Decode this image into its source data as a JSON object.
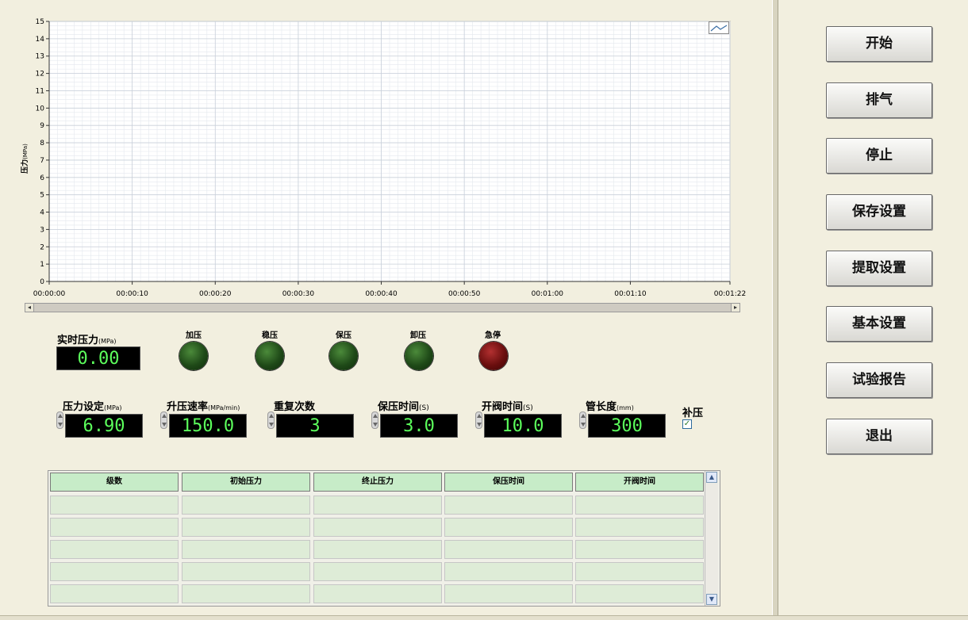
{
  "chart_data": {
    "type": "line",
    "ylabel": "压力",
    "ylabel_unit": "(MPa)",
    "ylim": [
      0,
      15
    ],
    "y_ticks": [
      "0",
      "1",
      "2",
      "3",
      "4",
      "5",
      "6",
      "7",
      "8",
      "9",
      "10",
      "11",
      "12",
      "13",
      "14",
      "15"
    ],
    "x_ticks": [
      "00:00:00",
      "00:00:10",
      "00:00:20",
      "00:00:30",
      "00:00:40",
      "00:00:50",
      "00:01:00",
      "00:01:10",
      "00:01:22"
    ],
    "x_tick_seconds": [
      0,
      10,
      20,
      30,
      40,
      50,
      60,
      70,
      82
    ],
    "xlim_seconds": [
      0,
      82
    ],
    "grid": true,
    "series": []
  },
  "realtime": {
    "label": "实时压力",
    "unit": "(MPa)",
    "value": "0.00"
  },
  "lamps": [
    {
      "label": "加压",
      "color": "green"
    },
    {
      "label": "稳压",
      "color": "green"
    },
    {
      "label": "保压",
      "color": "green"
    },
    {
      "label": "卸压",
      "color": "green"
    },
    {
      "label": "急停",
      "color": "red"
    }
  ],
  "params": [
    {
      "label": "压力设定",
      "unit": "(MPa)",
      "value": "6.90"
    },
    {
      "label": "升压速率",
      "unit": "(MPa/min)",
      "value": "150.0"
    },
    {
      "label": "重复次数",
      "unit": "",
      "value": "3"
    },
    {
      "label": "保压时间",
      "unit": "(S)",
      "value": "3.0"
    },
    {
      "label": "开阀时间",
      "unit": "(S)",
      "value": "10.0"
    },
    {
      "label": "管长度",
      "unit": "(mm)",
      "value": "300"
    }
  ],
  "supplement": {
    "label": "补压",
    "checked": true
  },
  "table": {
    "headers": [
      "级数",
      "初始压力",
      "终止压力",
      "保压时间",
      "开阀时间"
    ],
    "rows": [
      [
        "",
        "",
        "",
        "",
        ""
      ],
      [
        "",
        "",
        "",
        "",
        ""
      ],
      [
        "",
        "",
        "",
        "",
        ""
      ],
      [
        "",
        "",
        "",
        "",
        ""
      ],
      [
        "",
        "",
        "",
        "",
        ""
      ]
    ]
  },
  "buttons": [
    "开始",
    "排气",
    "停止",
    "保存设置",
    "提取设置",
    "基本设置",
    "试验报告",
    "退出"
  ]
}
